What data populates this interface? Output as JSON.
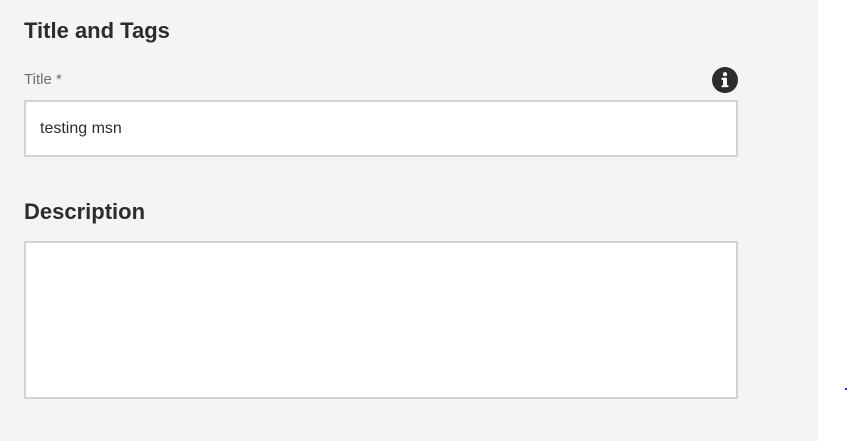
{
  "title_section": {
    "heading": "Title and Tags",
    "title_field": {
      "label": "Title *",
      "value": "testing msn",
      "info_icon": "info-icon"
    }
  },
  "description_section": {
    "heading": "Description",
    "value": ""
  },
  "colors": {
    "panel_background": "#f4f4f4",
    "field_border": "#d3d3d3",
    "heading_text": "#2c2c2c",
    "label_text": "#6e6e6e",
    "icon_fill": "#2c2c2c"
  }
}
